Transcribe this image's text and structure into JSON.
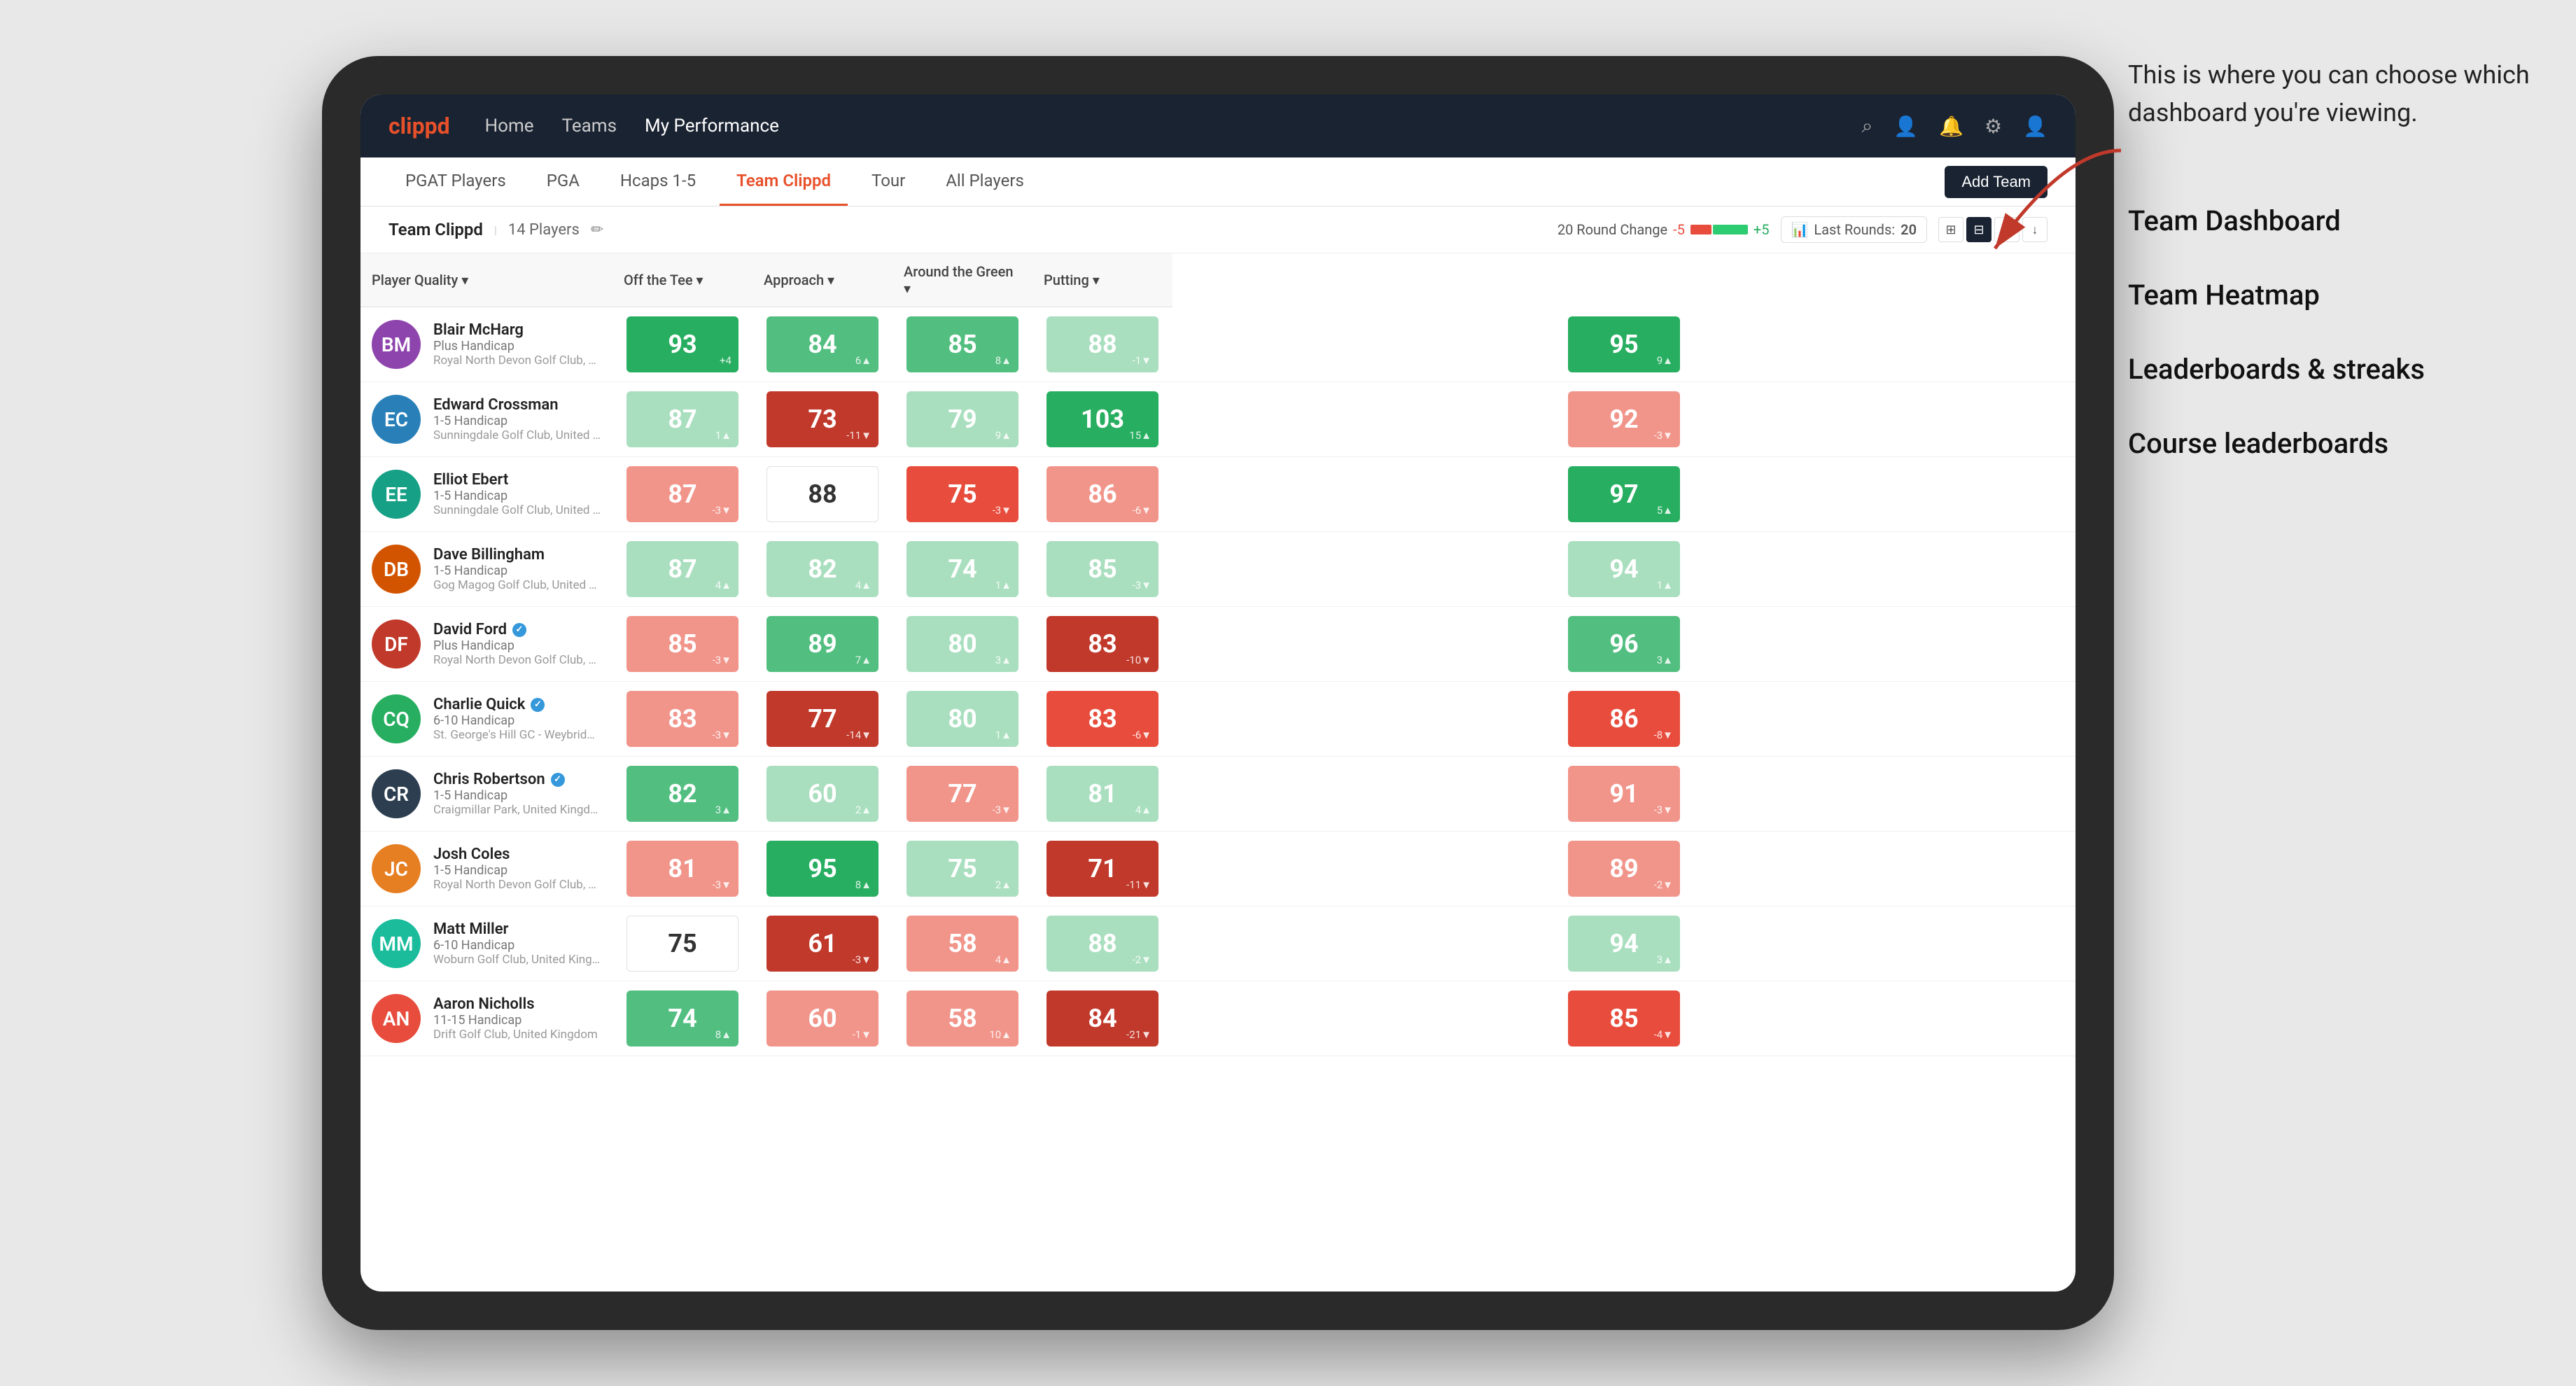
{
  "annotation": {
    "intro": "This is where you can choose which dashboard you're viewing.",
    "options": [
      "Team Dashboard",
      "Team Heatmap",
      "Leaderboards & streaks",
      "Course leaderboards"
    ]
  },
  "navbar": {
    "logo": "clippd",
    "nav_items": [
      "Home",
      "Teams",
      "My Performance"
    ],
    "active_nav": "My Performance"
  },
  "subnav": {
    "tabs": [
      "PGAT Players",
      "PGA",
      "Hcaps 1-5",
      "Team Clippd",
      "Tour",
      "All Players"
    ],
    "active_tab": "Team Clippd",
    "add_team_label": "Add Team"
  },
  "team_header": {
    "name": "Team Clippd",
    "separator": "|",
    "count": "14 Players",
    "round_change_label": "20 Round Change",
    "minus": "-5",
    "plus": "+5",
    "last_rounds_label": "Last Rounds:",
    "last_rounds_value": "20"
  },
  "table": {
    "columns": [
      "Player Quality ▾",
      "Off the Tee ▾",
      "Approach ▾",
      "Around the Green ▾",
      "Putting ▾"
    ],
    "rows": [
      {
        "name": "Blair McHarg",
        "handicap": "Plus Handicap",
        "club": "Royal North Devon Golf Club, United Kingdom",
        "verified": false,
        "scores": [
          {
            "value": 93,
            "change": "+4",
            "dir": "up",
            "color": "green-dark"
          },
          {
            "value": 84,
            "change": "6▲",
            "dir": "up",
            "color": "green-mid"
          },
          {
            "value": 85,
            "change": "8▲",
            "dir": "up",
            "color": "green-mid"
          },
          {
            "value": 88,
            "change": "-1▼",
            "dir": "down",
            "color": "green-light"
          },
          {
            "value": 95,
            "change": "9▲",
            "dir": "up",
            "color": "green-dark"
          }
        ]
      },
      {
        "name": "Edward Crossman",
        "handicap": "1-5 Handicap",
        "club": "Sunningdale Golf Club, United Kingdom",
        "verified": false,
        "scores": [
          {
            "value": 87,
            "change": "1▲",
            "dir": "up",
            "color": "green-light"
          },
          {
            "value": 73,
            "change": "-11▼",
            "dir": "down",
            "color": "red-dark"
          },
          {
            "value": 79,
            "change": "9▲",
            "dir": "up",
            "color": "green-light"
          },
          {
            "value": 103,
            "change": "15▲",
            "dir": "up",
            "color": "green-dark"
          },
          {
            "value": 92,
            "change": "-3▼",
            "dir": "down",
            "color": "red-light"
          }
        ]
      },
      {
        "name": "Elliot Ebert",
        "handicap": "1-5 Handicap",
        "club": "Sunningdale Golf Club, United Kingdom",
        "verified": false,
        "scores": [
          {
            "value": 87,
            "change": "-3▼",
            "dir": "down",
            "color": "red-light"
          },
          {
            "value": 88,
            "change": "",
            "dir": "none",
            "color": "none"
          },
          {
            "value": 75,
            "change": "-3▼",
            "dir": "down",
            "color": "red-mid"
          },
          {
            "value": 86,
            "change": "-6▼",
            "dir": "down",
            "color": "red-light"
          },
          {
            "value": 97,
            "change": "5▲",
            "dir": "up",
            "color": "green-dark"
          }
        ]
      },
      {
        "name": "Dave Billingham",
        "handicap": "1-5 Handicap",
        "club": "Gog Magog Golf Club, United Kingdom",
        "verified": false,
        "scores": [
          {
            "value": 87,
            "change": "4▲",
            "dir": "up",
            "color": "green-light"
          },
          {
            "value": 82,
            "change": "4▲",
            "dir": "up",
            "color": "green-light"
          },
          {
            "value": 74,
            "change": "1▲",
            "dir": "up",
            "color": "green-light"
          },
          {
            "value": 85,
            "change": "-3▼",
            "dir": "down",
            "color": "green-light"
          },
          {
            "value": 94,
            "change": "1▲",
            "dir": "up",
            "color": "green-light"
          }
        ]
      },
      {
        "name": "David Ford",
        "handicap": "Plus Handicap",
        "club": "Royal North Devon Golf Club, United Kingdom",
        "verified": true,
        "scores": [
          {
            "value": 85,
            "change": "-3▼",
            "dir": "down",
            "color": "red-light"
          },
          {
            "value": 89,
            "change": "7▲",
            "dir": "up",
            "color": "green-mid"
          },
          {
            "value": 80,
            "change": "3▲",
            "dir": "up",
            "color": "green-light"
          },
          {
            "value": 83,
            "change": "-10▼",
            "dir": "down",
            "color": "red-dark"
          },
          {
            "value": 96,
            "change": "3▲",
            "dir": "up",
            "color": "green-mid"
          }
        ]
      },
      {
        "name": "Charlie Quick",
        "handicap": "6-10 Handicap",
        "club": "St. George's Hill GC - Weybridge - Surrey, Uni...",
        "verified": true,
        "scores": [
          {
            "value": 83,
            "change": "-3▼",
            "dir": "down",
            "color": "red-light"
          },
          {
            "value": 77,
            "change": "-14▼",
            "dir": "down",
            "color": "red-dark"
          },
          {
            "value": 80,
            "change": "1▲",
            "dir": "up",
            "color": "green-light"
          },
          {
            "value": 83,
            "change": "-6▼",
            "dir": "down",
            "color": "red-mid"
          },
          {
            "value": 86,
            "change": "-8▼",
            "dir": "down",
            "color": "red-mid"
          }
        ]
      },
      {
        "name": "Chris Robertson",
        "handicap": "1-5 Handicap",
        "club": "Craigmillar Park, United Kingdom",
        "verified": true,
        "scores": [
          {
            "value": 82,
            "change": "3▲",
            "dir": "up",
            "color": "green-mid"
          },
          {
            "value": 60,
            "change": "2▲",
            "dir": "up",
            "color": "green-light"
          },
          {
            "value": 77,
            "change": "-3▼",
            "dir": "down",
            "color": "red-light"
          },
          {
            "value": 81,
            "change": "4▲",
            "dir": "up",
            "color": "green-light"
          },
          {
            "value": 91,
            "change": "-3▼",
            "dir": "down",
            "color": "red-light"
          }
        ]
      },
      {
        "name": "Josh Coles",
        "handicap": "1-5 Handicap",
        "club": "Royal North Devon Golf Club, United Kingdom",
        "verified": false,
        "scores": [
          {
            "value": 81,
            "change": "-3▼",
            "dir": "down",
            "color": "red-light"
          },
          {
            "value": 95,
            "change": "8▲",
            "dir": "up",
            "color": "green-dark"
          },
          {
            "value": 75,
            "change": "2▲",
            "dir": "up",
            "color": "green-light"
          },
          {
            "value": 71,
            "change": "-11▼",
            "dir": "down",
            "color": "red-dark"
          },
          {
            "value": 89,
            "change": "-2▼",
            "dir": "down",
            "color": "red-light"
          }
        ]
      },
      {
        "name": "Matt Miller",
        "handicap": "6-10 Handicap",
        "club": "Woburn Golf Club, United Kingdom",
        "verified": false,
        "scores": [
          {
            "value": 75,
            "change": "",
            "dir": "none",
            "color": "none"
          },
          {
            "value": 61,
            "change": "-3▼",
            "dir": "down",
            "color": "red-dark"
          },
          {
            "value": 58,
            "change": "4▲",
            "dir": "up",
            "color": "red-light"
          },
          {
            "value": 88,
            "change": "-2▼",
            "dir": "down",
            "color": "green-light"
          },
          {
            "value": 94,
            "change": "3▲",
            "dir": "up",
            "color": "green-light"
          }
        ]
      },
      {
        "name": "Aaron Nicholls",
        "handicap": "11-15 Handicap",
        "club": "Drift Golf Club, United Kingdom",
        "verified": false,
        "scores": [
          {
            "value": 74,
            "change": "8▲",
            "dir": "up",
            "color": "green-mid"
          },
          {
            "value": 60,
            "change": "-1▼",
            "dir": "down",
            "color": "red-light"
          },
          {
            "value": 58,
            "change": "10▲",
            "dir": "up",
            "color": "red-light"
          },
          {
            "value": 84,
            "change": "-21▼",
            "dir": "down",
            "color": "red-dark"
          },
          {
            "value": 85,
            "change": "-4▼",
            "dir": "down",
            "color": "red-mid"
          }
        ]
      }
    ]
  },
  "colors": {
    "green_dark": "#27ae60",
    "green_mid": "#52be80",
    "green_light": "#a9dfbf",
    "red_dark": "#c0392b",
    "red_mid": "#e74c3c",
    "red_light": "#f1948a",
    "none": "transparent",
    "navbar_bg": "#1a2332",
    "accent": "#e8502a"
  }
}
